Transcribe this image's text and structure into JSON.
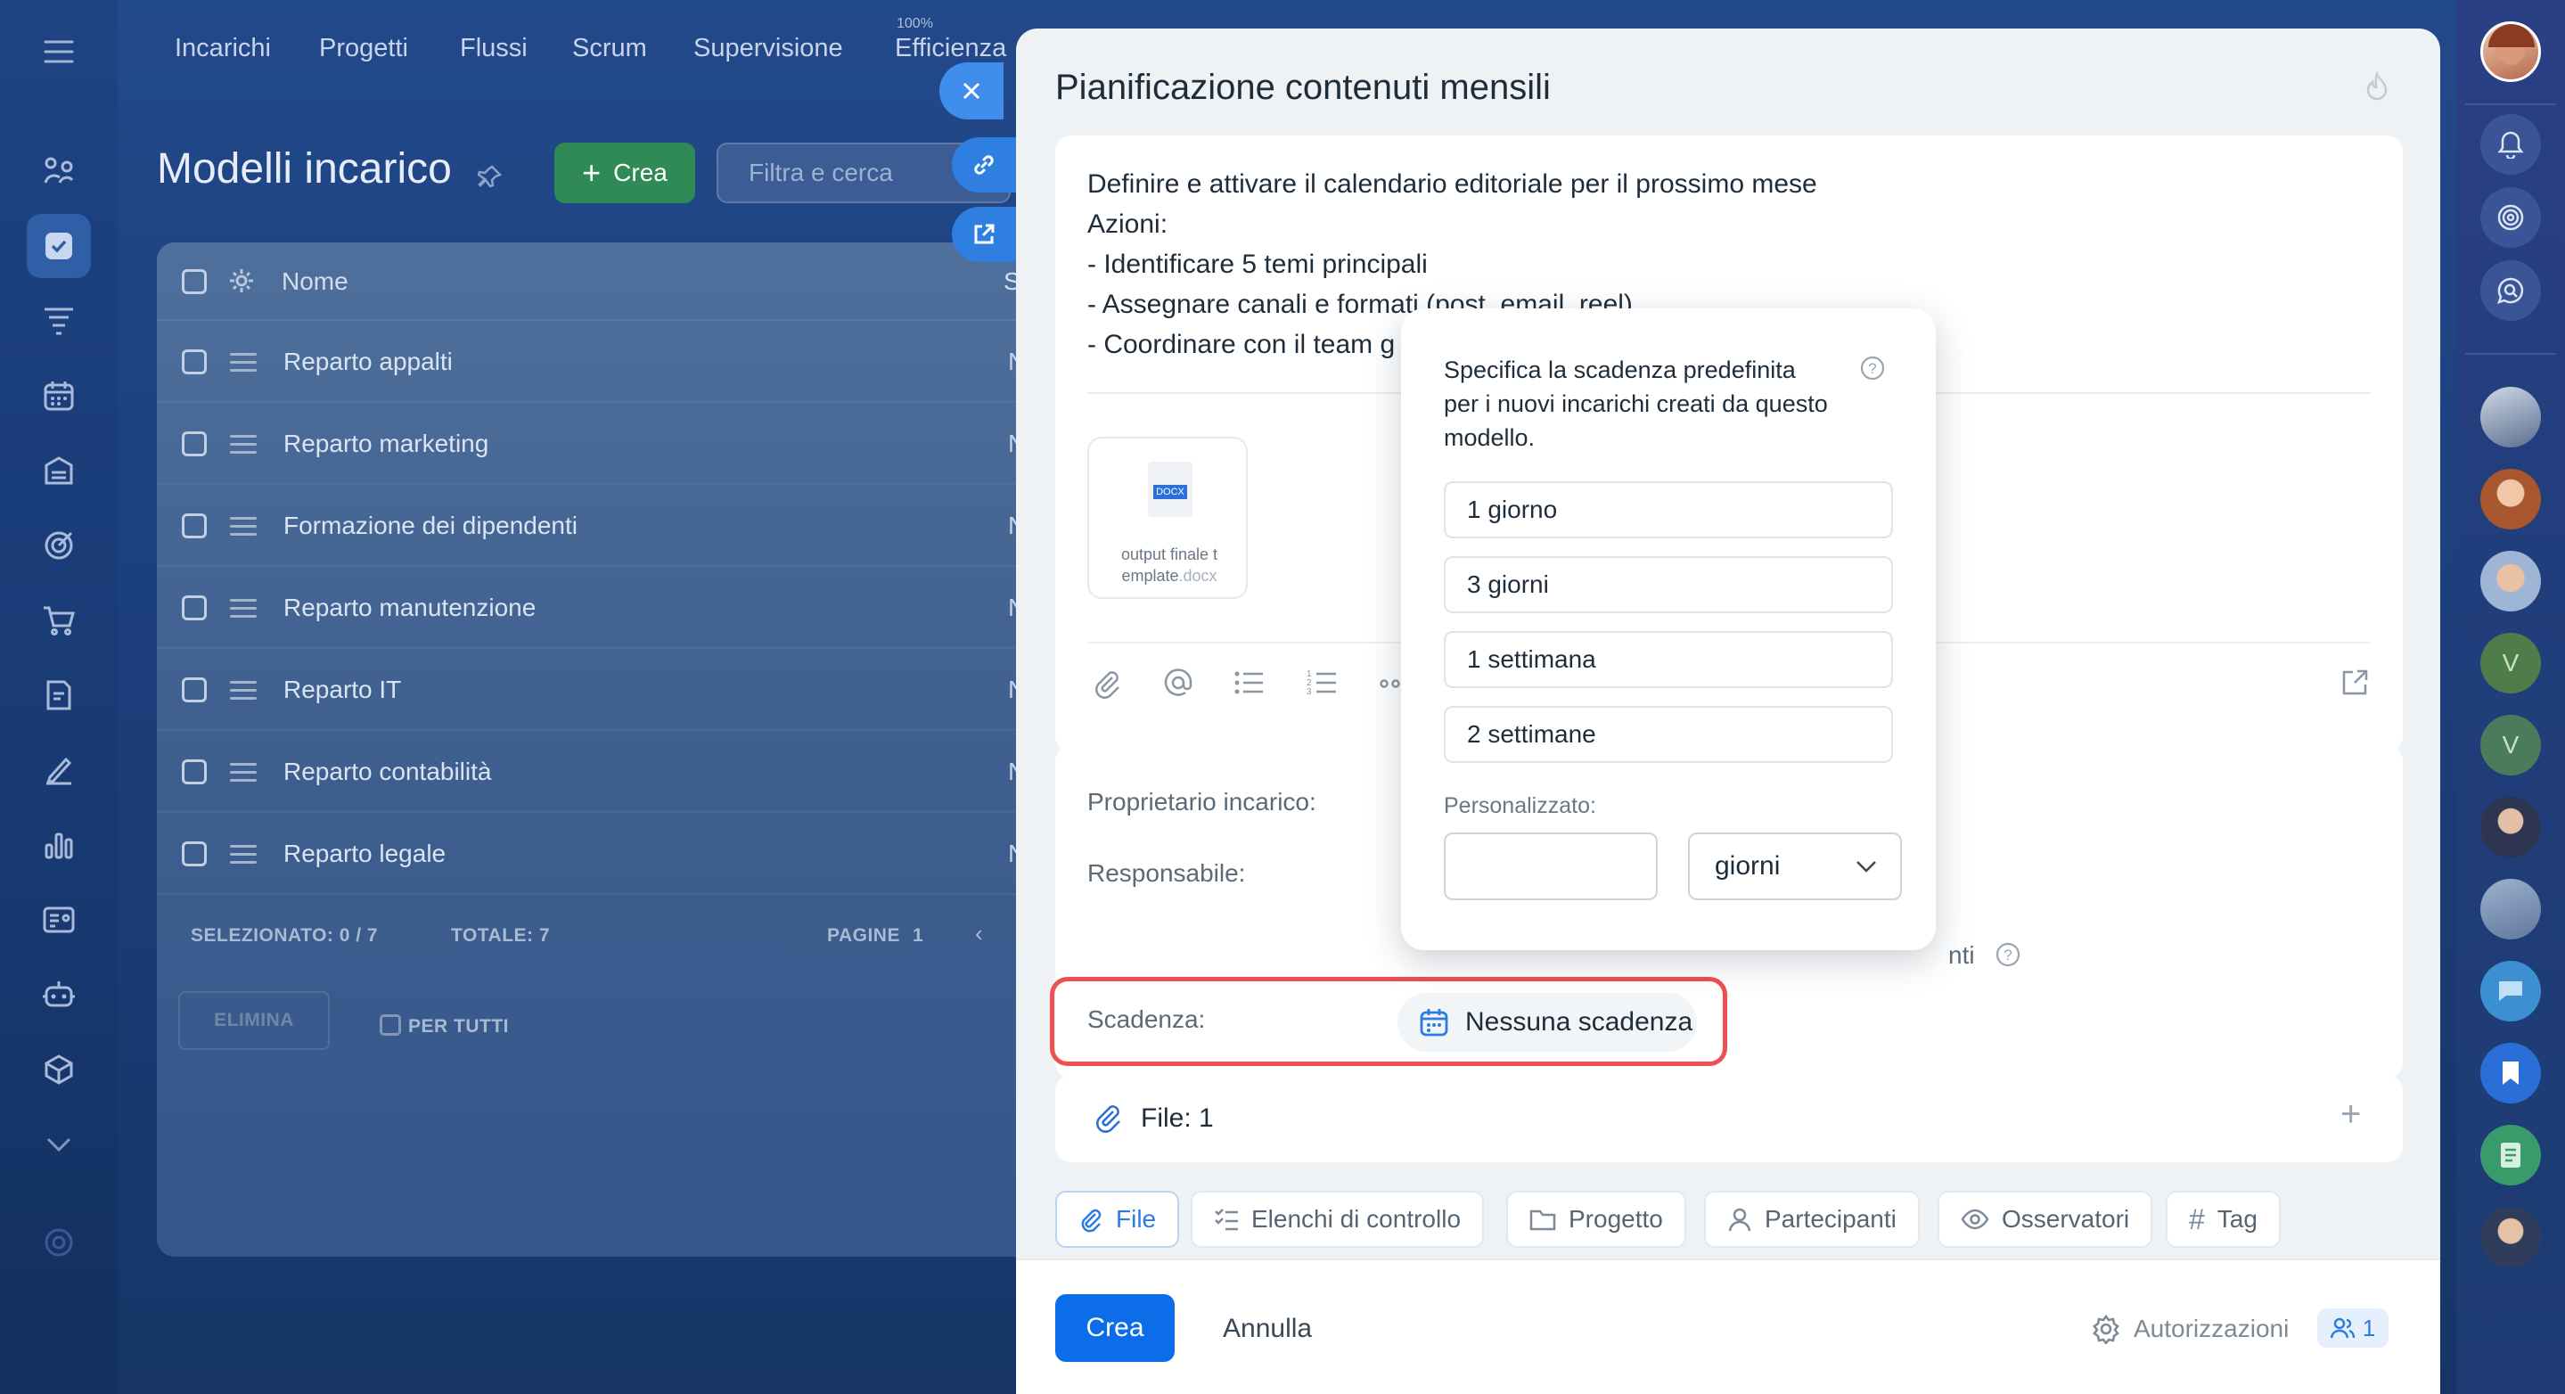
{
  "topnav": {
    "items": [
      "Incarichi",
      "Progetti",
      "Flussi",
      "Scrum",
      "Supervisione",
      "Efficienza"
    ],
    "efficiency_badge": "100%"
  },
  "page": {
    "title": "Modelli incarico",
    "create_label": "Crea",
    "filter_placeholder": "Filtra e cerca"
  },
  "grid": {
    "header_name": "Nome",
    "header_next": "S",
    "rows": [
      {
        "name": "Reparto appalti",
        "tail": "N"
      },
      {
        "name": "Reparto marketing",
        "tail": "N"
      },
      {
        "name": "Formazione dei dipendenti",
        "tail": "N"
      },
      {
        "name": "Reparto manutenzione",
        "tail": "N"
      },
      {
        "name": "Reparto IT",
        "tail": "N"
      },
      {
        "name": "Reparto contabilità",
        "tail": "N"
      },
      {
        "name": "Reparto legale",
        "tail": "N"
      }
    ],
    "footer": {
      "selected_label": "SELEZIONATO: 0 / 7",
      "total_label": "TOTALE: 7",
      "pages_label": "PAGINE",
      "pages_value": "1",
      "delete_label": "ELIMINA",
      "for_all_label": "PER TUTTI"
    }
  },
  "slider": {
    "title": "Pianificazione contenuti mensili",
    "description": [
      "Definire e attivare il calendario editoriale per il prossimo mese",
      "Azioni:",
      "- Identificare 5 temi principali",
      "- Assegnare canali e formati (post, email, reel)",
      "- Coordinare con il team g"
    ],
    "attachment": {
      "ext": "DOCX",
      "name_line1": "output finale t",
      "name_line2": "emplate",
      "name_ext": ".docx"
    },
    "fields": {
      "owner_label": "Proprietario incarico:",
      "responsible_label": "Responsabile:",
      "hidden_fragment": "nti",
      "deadline_label": "Scadenza:",
      "deadline_value": "Nessuna scadenza"
    },
    "files_label": "File: 1",
    "pills": [
      "File",
      "Elenchi di controllo",
      "Progetto",
      "Partecipanti",
      "Osservatori",
      "Tag"
    ],
    "bottom": {
      "create_label": "Crea",
      "cancel_label": "Annulla",
      "permissions_label": "Autorizzazioni",
      "permissions_count": "1"
    }
  },
  "popup": {
    "hint_line1": "Specifica la scadenza predefinita",
    "hint_line2": "per i nuovi incarichi creati da questo",
    "hint_line3": "modello.",
    "options": [
      "1 giorno",
      "3 giorni",
      "1 settimana",
      "2 settimane"
    ],
    "custom_label": "Personalizzato:",
    "custom_value": "",
    "unit_value": "giorni"
  },
  "rightnav": {
    "avatar_letters": [
      "V",
      "V"
    ]
  },
  "colors": {
    "accent": "#0b6ee8",
    "create_green": "#2f8a55",
    "highlight_red": "#ef4f4f",
    "slider_bg": "#eef2f4",
    "nav_bg": "#1e4383"
  }
}
